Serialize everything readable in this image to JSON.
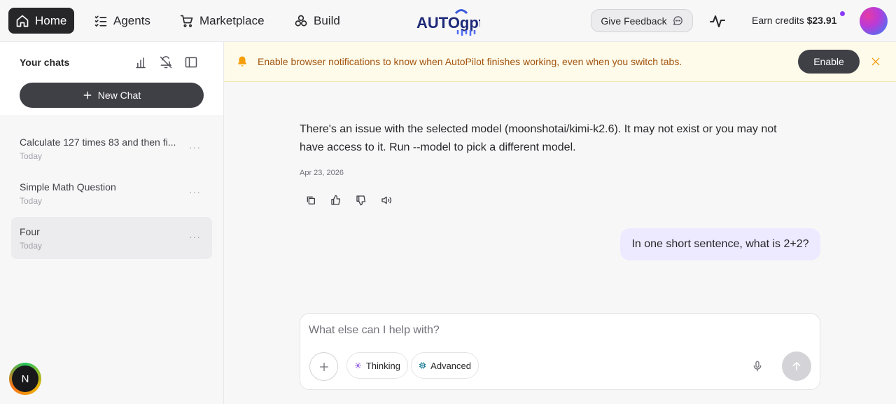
{
  "nav": {
    "home": "Home",
    "agents": "Agents",
    "marketplace": "Marketplace",
    "build": "Build"
  },
  "logo": {
    "text": "AUTOgpt"
  },
  "header": {
    "feedback_label": "Give Feedback",
    "credits_label": "Earn credits",
    "credits_amount": "$23.91"
  },
  "sidebar": {
    "title": "Your chats",
    "new_chat_label": "New Chat",
    "chats": [
      {
        "title": "Calculate 127 times 83 and then fi...",
        "date": "Today",
        "active": false
      },
      {
        "title": "Simple Math Question",
        "date": "Today",
        "active": false
      },
      {
        "title": "Four",
        "date": "Today",
        "active": true
      }
    ],
    "more_glyph": "···",
    "user_initial": "N"
  },
  "banner": {
    "text": "Enable browser notifications to know when AutoPilot finishes working, even when you switch tabs.",
    "enable_label": "Enable"
  },
  "conversation": {
    "assistant_message": "There's an issue with the selected model (moonshotai/kimi-k2.6). It may not exist or you may not have access to it. Run --model to pick a different model.",
    "assistant_date": "Apr 23, 2026",
    "user_message": "In one short sentence, what is 2+2?"
  },
  "composer": {
    "placeholder": "What else can I help with?",
    "thinking_label": "Thinking",
    "advanced_label": "Advanced"
  },
  "colors": {
    "nav_active_bg": "#27272a",
    "banner_bg": "#fefbea",
    "banner_text": "#a3540e",
    "user_bubble_bg": "#ede9fe",
    "credits_dot": "#8b3cf6"
  }
}
